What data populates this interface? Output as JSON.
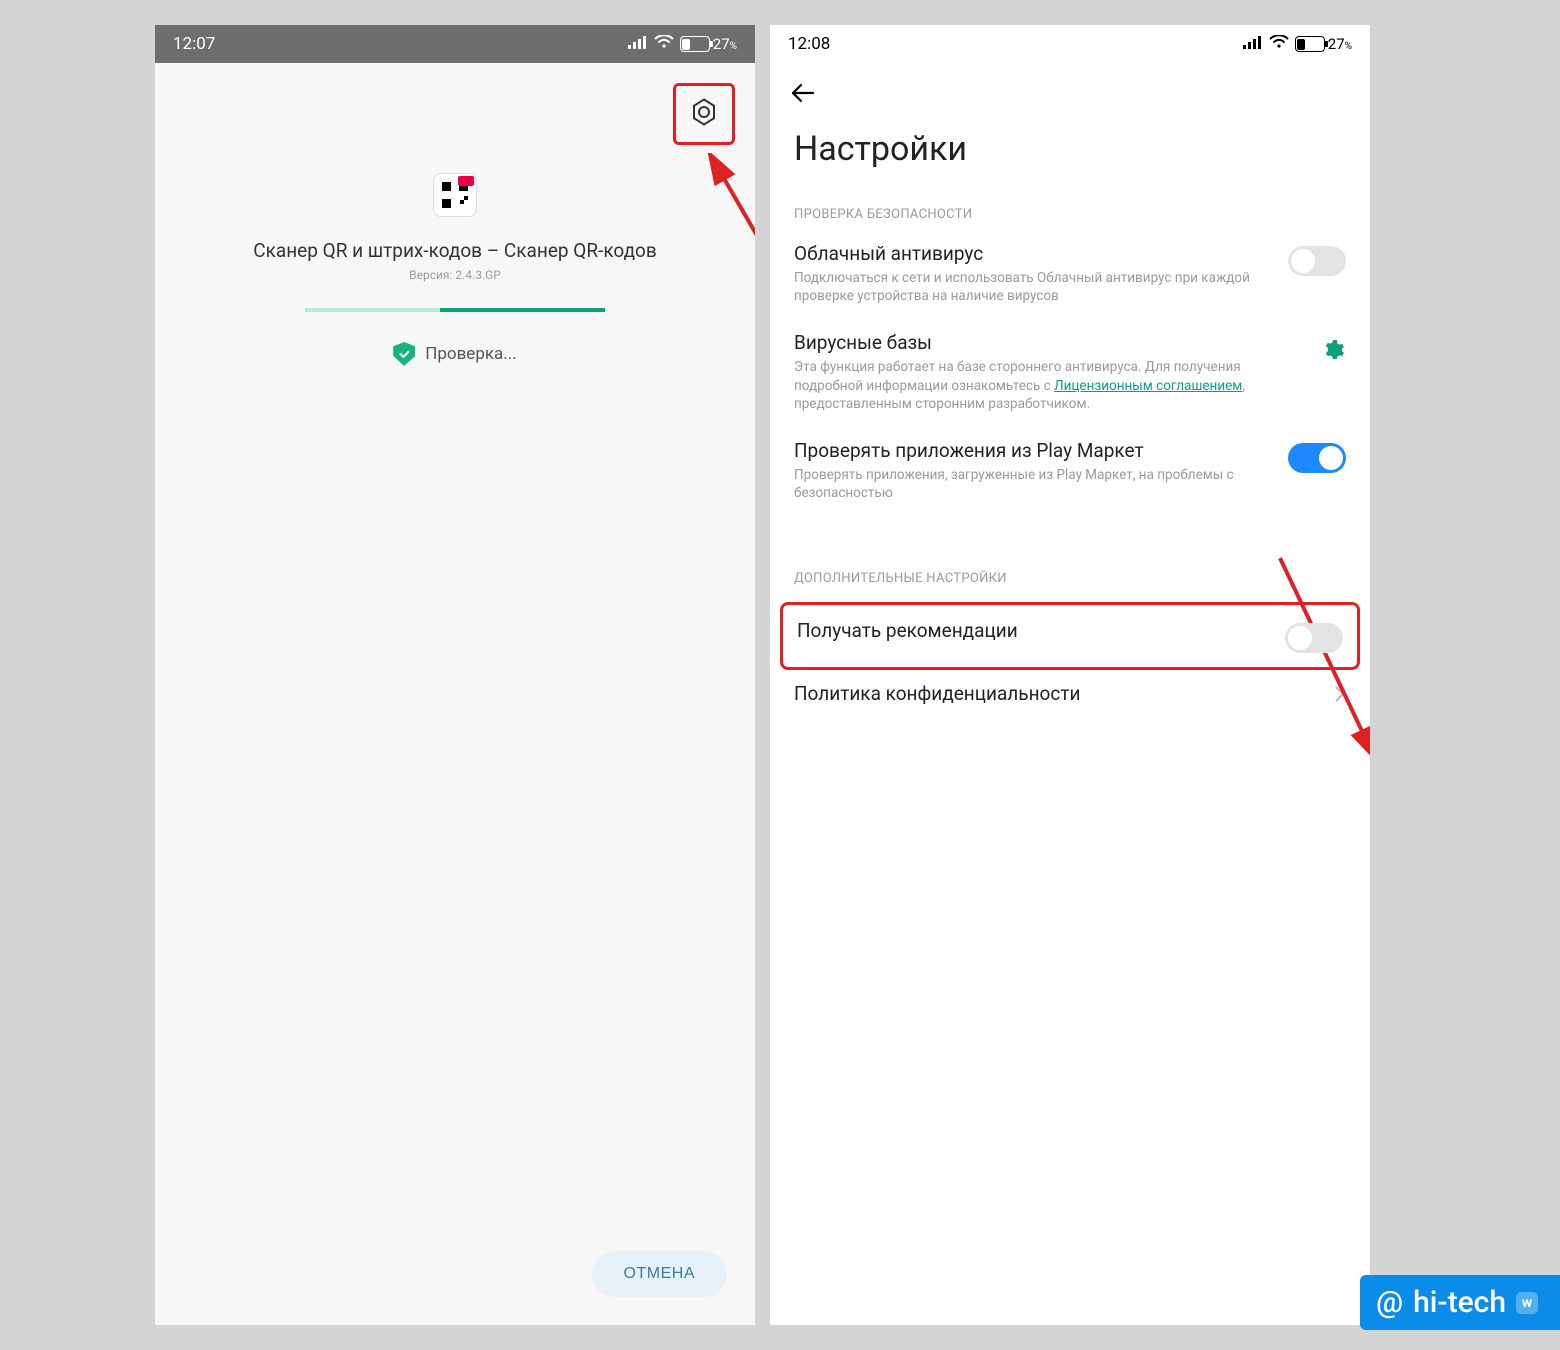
{
  "left": {
    "status": {
      "time": "12:07",
      "battery": "27",
      "battery_unit": "%"
    },
    "app": {
      "title": "Сканер QR и штрих-кодов – Сканер QR-кодов",
      "version_label": "Версия: 2.4.3.GP",
      "checking": "Проверка..."
    },
    "cancel": "ОТМЕНА"
  },
  "right": {
    "status": {
      "time": "12:08",
      "battery": "27",
      "battery_unit": "%"
    },
    "title": "Настройки",
    "section_security": "ПРОВЕРКА БЕЗОПАСНОСТИ",
    "section_additional": "ДОПОЛНИТЕЛЬНЫЕ НАСТРОЙКИ",
    "items": {
      "cloud_av": {
        "title": "Облачный антивирус",
        "desc": "Подключаться к сети и использовать Облачный антивирус при каждой проверке устройства на наличие вирусов"
      },
      "virus_db": {
        "title": "Вирусные базы",
        "desc_pre": "Эта функция работает на базе стороннего антивируса. Для получения подробной информации ознакомьтесь с ",
        "desc_link": "Лицензионным соглашением",
        "desc_post": ", предоставленным сторонним разработчиком."
      },
      "play_check": {
        "title": "Проверять приложения из Play Маркет",
        "desc": "Проверять приложения, загруженные из Play Маркет, на проблемы с безопасностью"
      },
      "recommend": {
        "title": "Получать рекомендации"
      },
      "privacy": {
        "title": "Политика конфиденциальности"
      }
    }
  },
  "watermark": {
    "at": "@",
    "text": "hi-tech",
    "badge": "w"
  }
}
